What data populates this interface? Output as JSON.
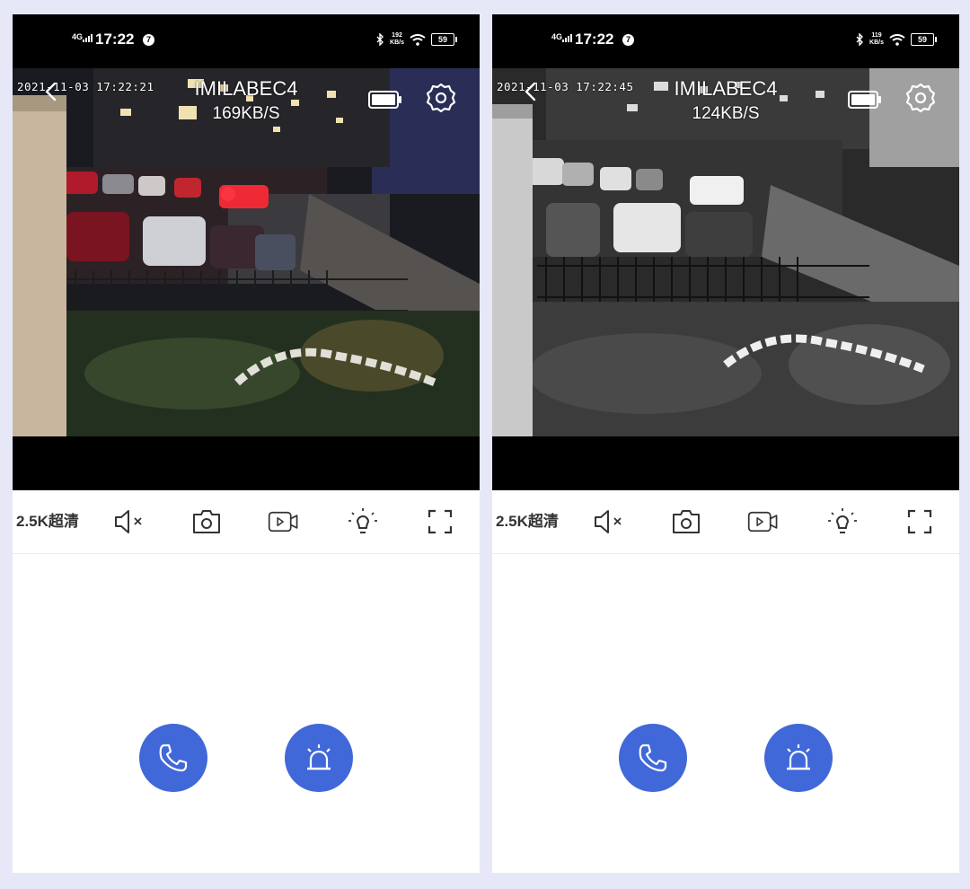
{
  "panels": [
    {
      "id": "left",
      "mode": "color night vision",
      "status": {
        "network": "4G",
        "time": "17:22",
        "badge": "7",
        "speed_value": "192",
        "speed_unit": "KB/s",
        "battery": "59"
      },
      "video": {
        "timestamp": "2021-11-03 17:22:21",
        "camera_name": "IMILABEC4",
        "bitrate": "169KB/S"
      },
      "toolbar": {
        "quality_label": "2.5K超清"
      }
    },
    {
      "id": "right",
      "mode": "black-and-white night vision",
      "status": {
        "network": "4G",
        "time": "17:22",
        "badge": "7",
        "speed_value": "119",
        "speed_unit": "KB/s",
        "battery": "59"
      },
      "video": {
        "timestamp": "2021-11-03 17:22:45",
        "camera_name": "IMILABEC4",
        "bitrate": "124KB/S"
      },
      "toolbar": {
        "quality_label": "2.5K超清"
      }
    }
  ],
  "icons": {
    "status": [
      "signal-icon",
      "bluetooth-icon",
      "wifi-icon",
      "battery-icon"
    ],
    "header": [
      "back-icon",
      "camera-battery-icon",
      "settings-icon"
    ],
    "toolbar": [
      "mute-icon",
      "snapshot-icon",
      "record-icon",
      "light-icon",
      "fullscreen-icon"
    ],
    "actions": [
      "phone-icon",
      "alarm-icon"
    ]
  },
  "colors": {
    "accent": "#4168d8",
    "background": "#e6e8f8",
    "status_bar": "#000000"
  }
}
